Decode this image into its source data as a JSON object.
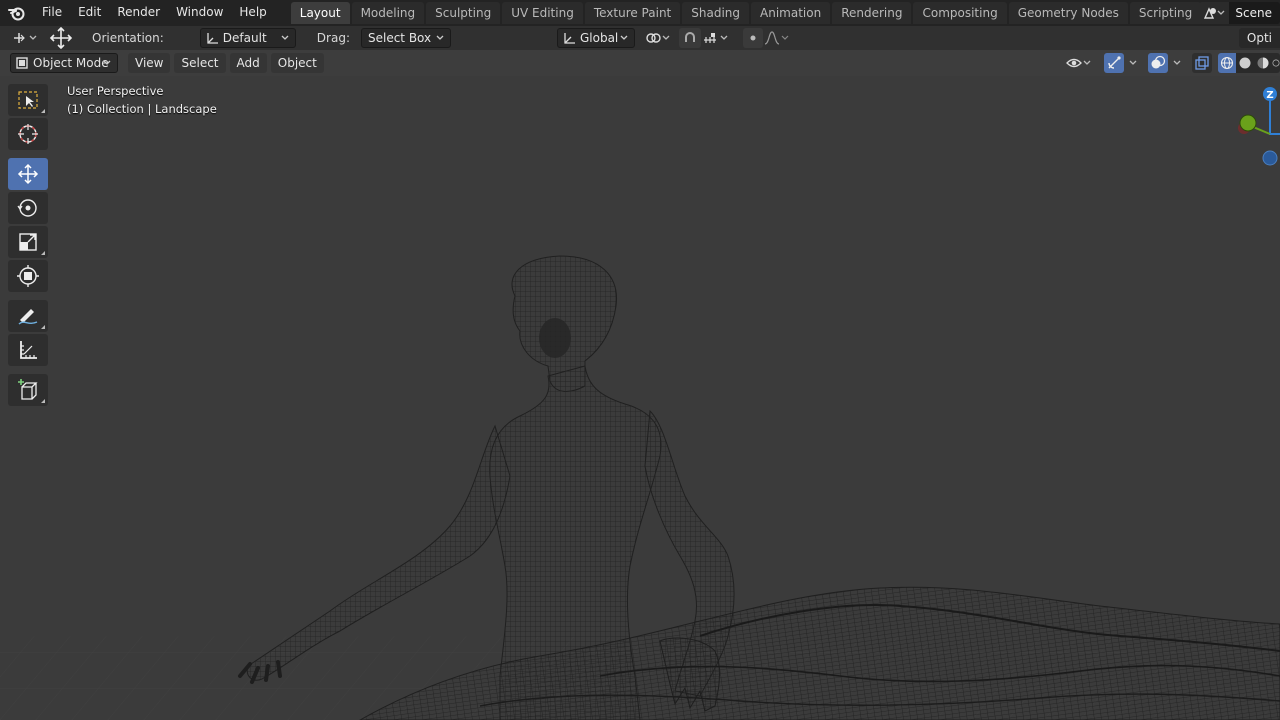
{
  "menu": {
    "items": [
      "File",
      "Edit",
      "Render",
      "Window",
      "Help"
    ]
  },
  "workspaces": {
    "tabs": [
      "Layout",
      "Modeling",
      "Sculpting",
      "UV Editing",
      "Texture Paint",
      "Shading",
      "Animation",
      "Rendering",
      "Compositing",
      "Geometry Nodes",
      "Scripting"
    ],
    "active": "Layout",
    "add_label": "+"
  },
  "scene": {
    "name": "Scene"
  },
  "toolheader": {
    "orientation_label": "Orientation:",
    "orientation_value": "Default",
    "drag_label": "Drag:",
    "drag_value": "Select Box",
    "transform_orientation": "Global",
    "options_label": "Opti"
  },
  "vpheader": {
    "mode": "Object Mode",
    "menus": [
      "View",
      "Select",
      "Add",
      "Object"
    ]
  },
  "viewport": {
    "perspective_label": "User Perspective",
    "collection_label": "(1) Collection | Landscape",
    "gizmo_z": "Z"
  },
  "toolbar": {
    "tools": [
      "select-box-icon",
      "cursor-icon",
      "move-icon",
      "rotate-icon",
      "scale-icon",
      "transform-icon",
      "annotate-icon",
      "measure-icon",
      "add-cube-icon"
    ],
    "active": "move-icon"
  },
  "colors": {
    "active_tab": "#3d3d3d",
    "active_tool": "#4f72b0",
    "viewport_bg": "#3b3b3b",
    "gizmo_z": "#2f7fd6",
    "gizmo_y": "#6aa11b",
    "gizmo_x": "#d23d3d"
  }
}
